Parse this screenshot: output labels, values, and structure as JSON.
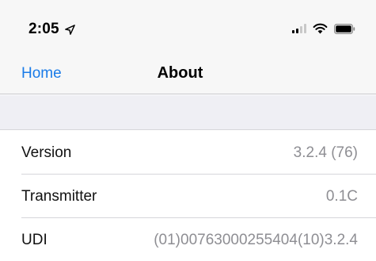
{
  "status_bar": {
    "time": "2:05",
    "icons": [
      "location-arrow-icon",
      "cellular-signal-icon",
      "wifi-icon",
      "battery-icon"
    ]
  },
  "nav": {
    "back_label": "Home",
    "title": "About"
  },
  "rows": [
    {
      "label": "Version",
      "value": "3.2.4 (76)"
    },
    {
      "label": "Transmitter",
      "value": "0.1C"
    },
    {
      "label": "UDI",
      "value": "(01)00763000255404(10)3.2.4"
    }
  ],
  "colors": {
    "accent": "#1a7be8",
    "secondary_text": "#8e8e93",
    "separator": "#d6d6da",
    "grouped_background": "#efeff4"
  }
}
